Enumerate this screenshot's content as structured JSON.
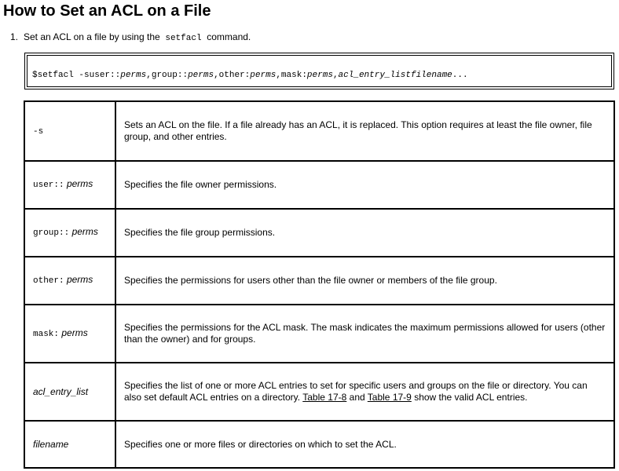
{
  "title": "How to Set an ACL on a File",
  "step": {
    "number": "1.",
    "text_before": "Set an ACL on a file by using the",
    "command_name": "setfacl",
    "text_after": "command."
  },
  "command": {
    "prompt": "$",
    "cmd": "setfacl -s",
    "user": "user::",
    "perms1": "perms",
    "group": ",group::",
    "perms2": "perms",
    "other": ",other:",
    "perms3": "perms",
    "mask": ",mask:",
    "perms4": "perms",
    "sep": ",",
    "acl_entry_list": "acl_entry_list",
    "filename": "filename",
    "ellipsis": "..."
  },
  "options": [
    {
      "mono": "-s",
      "ital": "",
      "desc": "Sets an ACL on the file. If a file already has an ACL, it is replaced. This option requires at least the file owner, file group, and other entries."
    },
    {
      "mono": "user::",
      "ital": "perms",
      "desc": "Specifies the file owner permissions."
    },
    {
      "mono": "group::",
      "ital": "perms",
      "desc": "Specifies the file group permissions."
    },
    {
      "mono": "other:",
      "ital": "perms",
      "desc": "Specifies the permissions for users other than the file owner or members of the file group."
    },
    {
      "mono": "mask:",
      "ital": "perms",
      "desc": "Specifies the permissions for the ACL mask. The mask indicates the maximum permissions allowed for users (other than the owner) and for groups."
    },
    {
      "mono": "",
      "ital": "acl_entry_list",
      "desc_before": "Specifies the list of one or more ACL entries to set for specific users and groups on the file or directory. You can also set default ACL entries on a directory.",
      "link1": "Table 17-8",
      "desc_mid": "and",
      "link2": "Table 17-9",
      "desc_after": "show the valid ACL entries."
    },
    {
      "mono": "",
      "ital": "filename",
      "desc": "Specifies one or more files or directories on which to set the ACL."
    }
  ]
}
